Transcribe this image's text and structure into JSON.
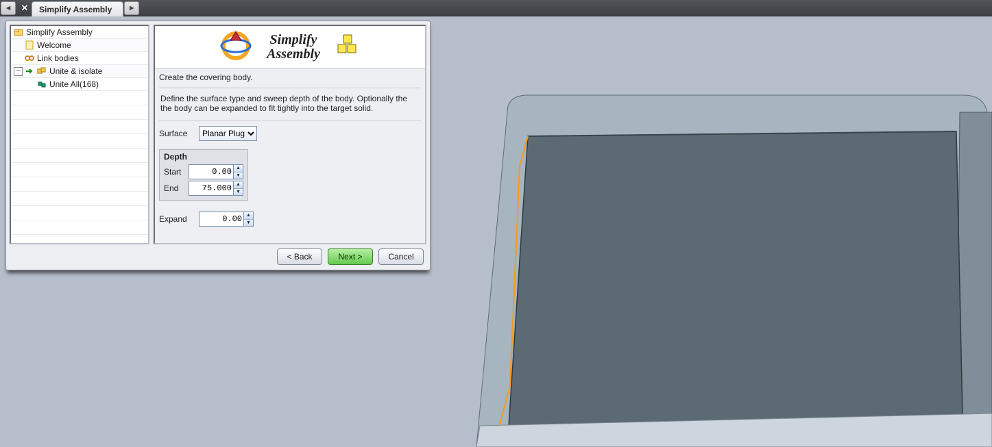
{
  "tabbar": {
    "prev_label": "◄",
    "close_label": "✕",
    "active_tab": "Simplify Assembly",
    "next_label": "►"
  },
  "tree": {
    "root": "Simplify Assembly",
    "items": [
      {
        "label": "Welcome",
        "icon": "wizard"
      },
      {
        "label": "Link bodies",
        "icon": "link"
      }
    ],
    "unite": {
      "label": "Unite & isolate",
      "child": "Unite All(168)"
    }
  },
  "panel": {
    "title_line1": "Simplify",
    "title_line2": "Assembly",
    "subheading": "Create the covering body.",
    "description": "Define the surface type and sweep depth of the body. Optionally the the body can be expanded to fit tightly into the target solid.",
    "surface_label": "Surface",
    "surface_value": "Planar Plug",
    "depth": {
      "legend": "Depth",
      "start_label": "Start",
      "start_value": "0.00",
      "end_label": "End",
      "end_value": "75.000"
    },
    "expand_label": "Expand",
    "expand_value": "0.00"
  },
  "buttons": {
    "back": "< Back",
    "next": "Next >",
    "cancel": "Cancel"
  }
}
